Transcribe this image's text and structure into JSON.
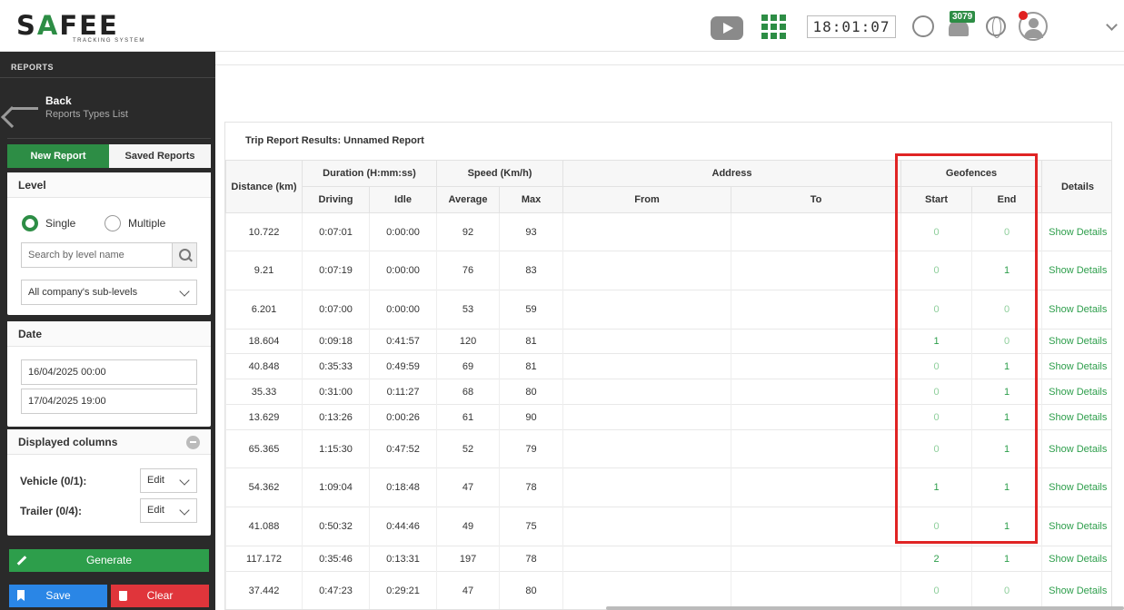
{
  "header": {
    "logo_main": "S",
    "logo_a": "A",
    "logo_rest": "FEE",
    "logo_sub": "TRACKING SYSTEM",
    "clock": "18:01:07",
    "notifications": "3079"
  },
  "sidebar": {
    "title": "REPORTS",
    "back_title": "Back",
    "back_sub": "Reports Types List",
    "tab_new": "New Report",
    "tab_saved": "Saved Reports",
    "level": {
      "title": "Level",
      "single": "Single",
      "multiple": "Multiple",
      "search_placeholder": "Search by level name",
      "select_value": "All company's sub-levels"
    },
    "date": {
      "title": "Date",
      "from": "16/04/2025 00:00",
      "to": "17/04/2025 19:00"
    },
    "columns": {
      "title": "Displayed columns",
      "vehicle": "Vehicle (0/1):",
      "trailer": "Trailer (0/4):",
      "edit": "Edit"
    },
    "generate": "Generate",
    "save": "Save",
    "clear": "Clear"
  },
  "results": {
    "title": "Trip Report Results: Unnamed Report",
    "headers": {
      "distance": "Distance (km)",
      "duration": "Duration (H:mm:ss)",
      "driving": "Driving",
      "idle": "Idle",
      "speed": "Speed (Km/h)",
      "average": "Average",
      "max": "Max",
      "address": "Address",
      "from": "From",
      "to": "To",
      "geofences": "Geofences",
      "start": "Start",
      "end": "End",
      "details": "Details"
    },
    "details_label": "Show Details",
    "rows": [
      {
        "distance": "10.722",
        "driving": "0:07:01",
        "idle": "0:00:00",
        "avg": "92",
        "max": "93",
        "start": "0",
        "end": "0",
        "h": 42
      },
      {
        "distance": "9.21",
        "driving": "0:07:19",
        "idle": "0:00:00",
        "avg": "76",
        "max": "83",
        "start": "0",
        "end": "1",
        "h": 43
      },
      {
        "distance": "6.201",
        "driving": "0:07:00",
        "idle": "0:00:00",
        "avg": "53",
        "max": "59",
        "start": "0",
        "end": "0",
        "h": 43
      },
      {
        "distance": "18.604",
        "driving": "0:09:18",
        "idle": "0:41:57",
        "avg": "120",
        "max": "81",
        "start": "1",
        "end": "0",
        "h": 27
      },
      {
        "distance": "40.848",
        "driving": "0:35:33",
        "idle": "0:49:59",
        "avg": "69",
        "max": "81",
        "start": "0",
        "end": "1",
        "h": 28
      },
      {
        "distance": "35.33",
        "driving": "0:31:00",
        "idle": "0:11:27",
        "avg": "68",
        "max": "80",
        "start": "0",
        "end": "1",
        "h": 28
      },
      {
        "distance": "13.629",
        "driving": "0:13:26",
        "idle": "0:00:26",
        "avg": "61",
        "max": "90",
        "start": "0",
        "end": "1",
        "h": 28
      },
      {
        "distance": "65.365",
        "driving": "1:15:30",
        "idle": "0:47:52",
        "avg": "52",
        "max": "79",
        "start": "0",
        "end": "1",
        "h": 42
      },
      {
        "distance": "54.362",
        "driving": "1:09:04",
        "idle": "0:18:48",
        "avg": "47",
        "max": "78",
        "start": "1",
        "end": "1",
        "h": 43
      },
      {
        "distance": "41.088",
        "driving": "0:50:32",
        "idle": "0:44:46",
        "avg": "49",
        "max": "75",
        "start": "0",
        "end": "1",
        "h": 43
      },
      {
        "distance": "117.172",
        "driving": "0:35:46",
        "idle": "0:13:31",
        "avg": "197",
        "max": "78",
        "start": "2",
        "end": "1",
        "h": 28
      },
      {
        "distance": "37.442",
        "driving": "0:47:23",
        "idle": "0:29:21",
        "avg": "47",
        "max": "80",
        "start": "0",
        "end": "0",
        "h": 42
      }
    ]
  }
}
